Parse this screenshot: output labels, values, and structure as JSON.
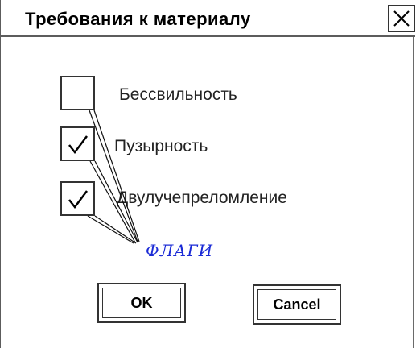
{
  "window": {
    "title": "Требования к материалу"
  },
  "checkboxes": [
    {
      "label": "Бессвильность",
      "checked": false
    },
    {
      "label": "Пузырность",
      "checked": true
    },
    {
      "label": "Двулучепреломление",
      "checked": true
    }
  ],
  "annotation": {
    "text": "ФЛАГИ"
  },
  "buttons": {
    "ok_label": "OK",
    "cancel_label": "Cancel"
  },
  "icons": {
    "close": "close-icon",
    "check": "check-icon"
  }
}
